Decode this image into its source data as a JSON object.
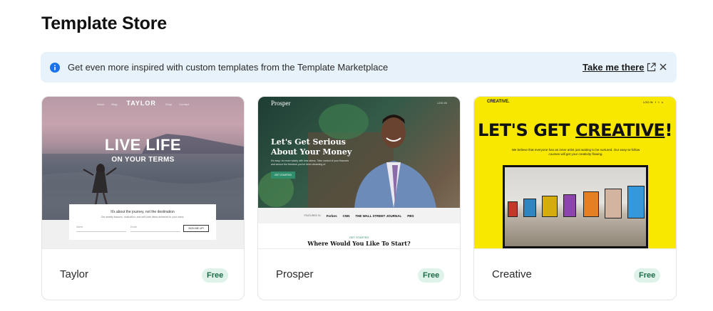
{
  "page": {
    "title": "Template Store"
  },
  "banner": {
    "message": "Get even more inspired with custom templates from the Template Marketplace",
    "link_label": "Take me there"
  },
  "templates": [
    {
      "name": "Taylor",
      "price": "Free",
      "preview": {
        "brand": "TAYLOR",
        "headline": "LIVE LIFE",
        "subheadline": "ON YOUR TERMS",
        "form_title": "It's about the journey, not the destination",
        "form_button": "SIGN ME UP!"
      }
    },
    {
      "name": "Prosper",
      "price": "Free",
      "preview": {
        "brand": "Prosper",
        "headline": "Let's Get Serious About Your Money",
        "button": "GET STARTED",
        "featured_label": "FEATURED IN",
        "featured": [
          "Forbes",
          "CNN",
          "THE WALL STREET JOURNAL",
          "PBS"
        ],
        "section_tag": "GET STARTED",
        "section_title": "Where Would You Like To Start?"
      }
    },
    {
      "name": "Creative",
      "price": "Free",
      "preview": {
        "brand": "CREATIVE.",
        "headline_plain": "LET'S GET ",
        "headline_underlined": "CREATIVE",
        "headline_end": "!",
        "body": "We believe that everyone has an inner artist just waiting to be nurtured. Our easy-to-follow courses will get your creativity flowing."
      }
    }
  ],
  "colors": {
    "banner_bg": "#e7f2fb",
    "info_icon": "#1a73e8",
    "badge_bg": "#dff3ea",
    "badge_text": "#1e6b49"
  }
}
